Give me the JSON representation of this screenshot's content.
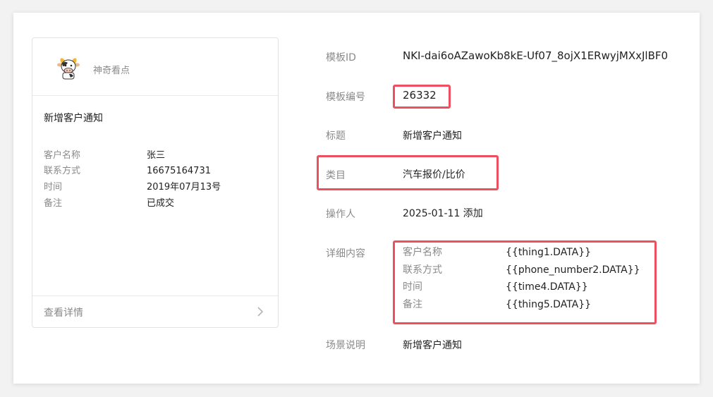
{
  "preview": {
    "account_name": "神奇看点",
    "title": "新增客户通知",
    "fields": [
      {
        "key": "客户名称",
        "value": "张三"
      },
      {
        "key": "联系方式",
        "value": "16675164731"
      },
      {
        "key": "时间",
        "value": "2019年07月13号"
      },
      {
        "key": "备注",
        "value": "已成交"
      }
    ],
    "footer_label": "查看详情"
  },
  "info": {
    "template_id_label": "模板ID",
    "template_id_value": "NKI-dai6oAZawoKb8kE-Uf07_8ojX1ERwyjMXxJlBF0",
    "template_no_label": "模板编号",
    "template_no_value": "26332",
    "title_label": "标题",
    "title_value": "新增客户通知",
    "category_label": "类目",
    "category_value": "汽车报价/比价",
    "operator_label": "操作人",
    "operator_value": "2025-01-11 添加",
    "detail_label": "详细内容",
    "details": [
      {
        "key": "客户名称",
        "value": "{{thing1.DATA}}"
      },
      {
        "key": "联系方式",
        "value": "{{phone_number2.DATA}}"
      },
      {
        "key": "时间",
        "value": "{{time4.DATA}}"
      },
      {
        "key": "备注",
        "value": "{{thing5.DATA}}"
      }
    ],
    "scene_label": "场景说明",
    "scene_value": "新增客户通知"
  },
  "colors": {
    "highlight": "#ee4f60",
    "muted_text": "#8a8a8a"
  },
  "icons": {
    "avatar": "cow-avatar-icon",
    "footer": "chevron-right-icon"
  }
}
